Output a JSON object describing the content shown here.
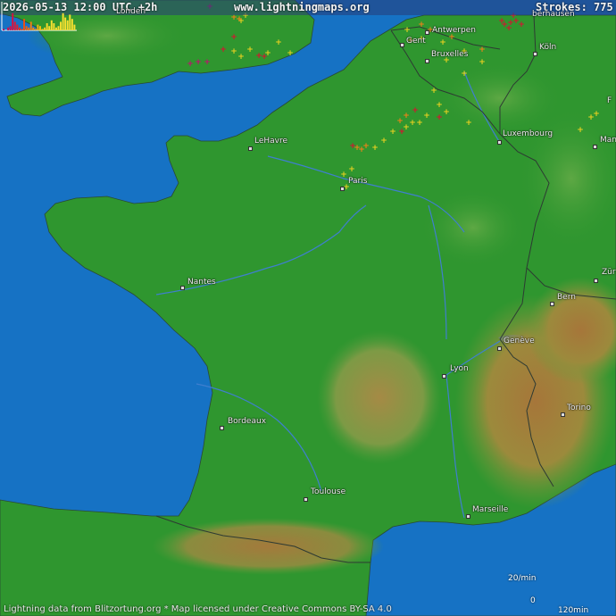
{
  "header": {
    "timestamp": "2026-05-13 12:00 UTC +2h",
    "site": "www.lightningmaps.org",
    "strokes_label": "Strokes: 775"
  },
  "cities": [
    {
      "id": "le-havre",
      "label": "LeHavre"
    },
    {
      "id": "paris",
      "label": "Paris"
    },
    {
      "id": "nantes",
      "label": "Nantes"
    },
    {
      "id": "bordeaux",
      "label": "Bordeaux"
    },
    {
      "id": "toulouse",
      "label": "Toulouse"
    },
    {
      "id": "marseille",
      "label": "Marseille"
    },
    {
      "id": "lyon",
      "label": "Lyon"
    },
    {
      "id": "geneve",
      "label": "Genève"
    },
    {
      "id": "bern",
      "label": "Bern"
    },
    {
      "id": "torino",
      "label": "Torino"
    },
    {
      "id": "luxembourg",
      "label": "Luxembourg"
    },
    {
      "id": "bruxelles",
      "label": "Bruxelles"
    },
    {
      "id": "gent",
      "label": "Gent"
    },
    {
      "id": "antwerpen",
      "label": "Antwerpen"
    },
    {
      "id": "koln",
      "label": "Köln"
    },
    {
      "id": "mannheim",
      "label": "Mann"
    },
    {
      "id": "zurich",
      "label": "Zür"
    },
    {
      "id": "f-city",
      "label": "F"
    },
    {
      "id": "london",
      "label": "Londen"
    },
    {
      "id": "oberhausen",
      "label": "berhausen"
    }
  ],
  "footer": {
    "text": "Lightning data from Blitzortung.org  *  Map licensed under Creative Commons BY-SA 4.0"
  },
  "histogram": {
    "ymax_label": "20/min",
    "zero_label": "0",
    "xlabel": "120min",
    "values": [
      1,
      0,
      2,
      3,
      12,
      6,
      4,
      2,
      1,
      8,
      3,
      2,
      6,
      2,
      1,
      4,
      3,
      1,
      2,
      5,
      3,
      7,
      5,
      2,
      3,
      6,
      12,
      9,
      7,
      11,
      8,
      4
    ],
    "colors": [
      "#c00060",
      "#c00060",
      "#d01050",
      "#d01050",
      "#d81040",
      "#e01838",
      "#e02030",
      "#e83020",
      "#e84018",
      "#ee5010",
      "#ee6010",
      "#f07010",
      "#f08010",
      "#f49010",
      "#f4a010",
      "#f4b010",
      "#f8c010",
      "#f8c818",
      "#f8d020",
      "#f8d828",
      "#f8e030",
      "#f8e030",
      "#f8e030",
      "#f8e030",
      "#f8e030",
      "#f8e030",
      "#f8e030",
      "#f8e030",
      "#f8e030",
      "#f8e030",
      "#f8e030",
      "#f8e030"
    ]
  },
  "colors": {
    "sea": "#1672c4",
    "land": "#2f962f",
    "mountain": "#b9863a",
    "border": "#2d3a33",
    "river": "#3f7fcf"
  }
}
